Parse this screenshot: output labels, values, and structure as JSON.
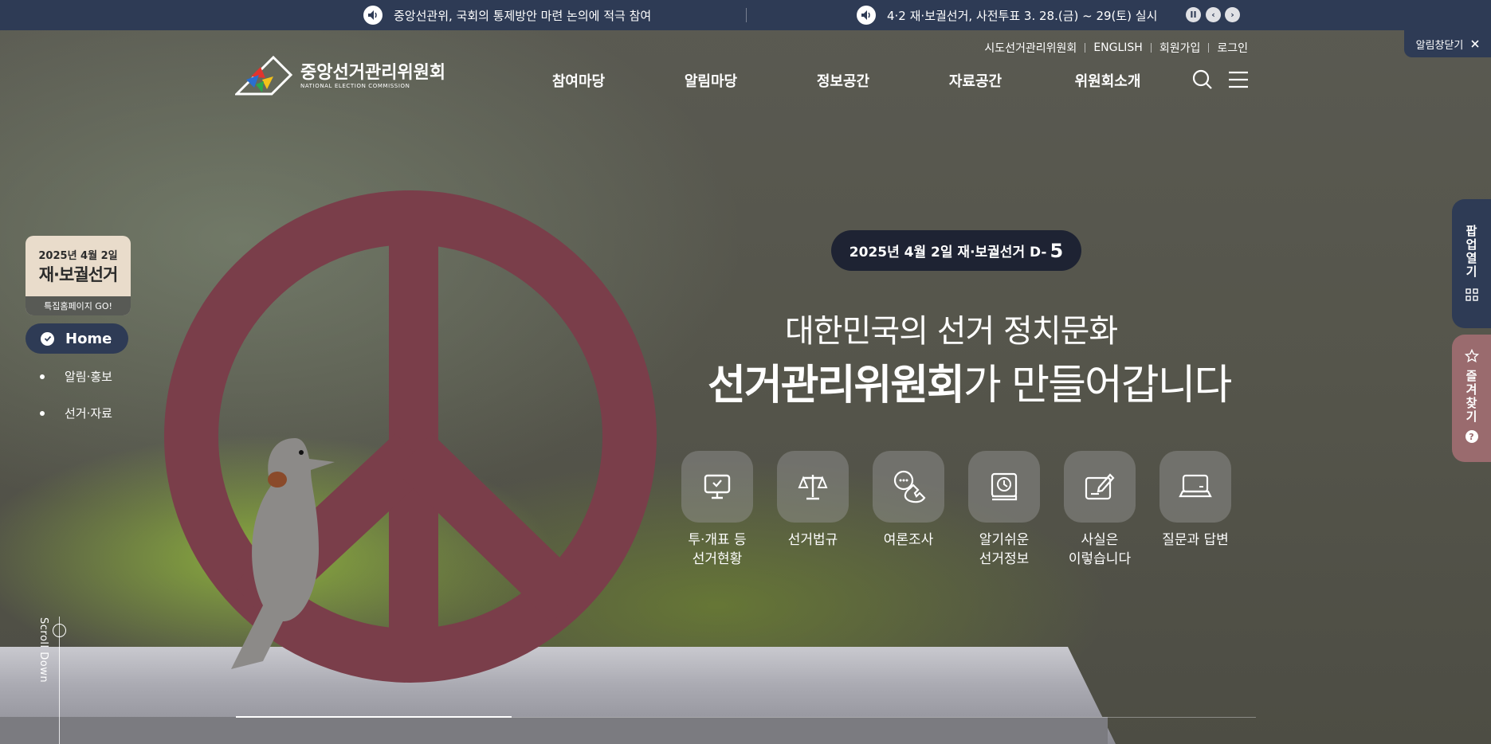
{
  "notices": [
    {
      "text": "중앙선관위, 국회의 통제방안 마련 논의에 적극 참여"
    },
    {
      "text": "4·2 재·보궐선거, 사전투표 3. 28.(금) ~ 29(토) 실시"
    }
  ],
  "notice_controls": {
    "pause": "II",
    "prev": "‹",
    "next": "›"
  },
  "alert_close": {
    "label": "알림창닫기",
    "icon": "close-icon"
  },
  "utility_links": [
    "시도선거관리위원회",
    "ENGLISH",
    "회원가입",
    "로그인"
  ],
  "logo": {
    "title": "중앙선거관리위원회",
    "subtitle": "NATIONAL ELECTION COMMISSION"
  },
  "nav": [
    "참여마당",
    "알림마당",
    "정보공간",
    "자료공간",
    "위원회소개"
  ],
  "special_banner": {
    "date": "2025년 4월 2일",
    "title": "재·보궐선거",
    "link": "특집홈페이지 GO!"
  },
  "sidebar": {
    "home": "Home",
    "items": [
      "알림·홍보",
      "선거·자료"
    ]
  },
  "scroll_text": "Scroll Down",
  "hero": {
    "dday_prefix": "2025년 4월 2일 재·보궐선거 D-",
    "dday_number": "5",
    "line1": "대한민국의 선거 정치문화",
    "line2_bold": "선거관리위원회",
    "line2_rest": "가 만들어갑니다"
  },
  "quick_links": [
    {
      "label": "투·개표 등\n선거현황",
      "icon": "monitor-icon"
    },
    {
      "label": "선거법규",
      "icon": "scale-icon"
    },
    {
      "label": "여론조사",
      "icon": "phone-chat-icon"
    },
    {
      "label": "알기쉬운\n선거정보",
      "icon": "book-clock-icon"
    },
    {
      "label": "사실은\n이렇습니다",
      "icon": "edit-board-icon"
    },
    {
      "label": "질문과 답변",
      "icon": "laptop-icon"
    }
  ],
  "right_tabs": {
    "popup": "팝업열기",
    "favorite": "즐겨찾기",
    "help": "?"
  },
  "slider_progress": 0.27,
  "colors": {
    "navy": "#2e3b55",
    "dark_pill": "#1e2333",
    "favorite": "#9a6b6e",
    "peace_sign": "#7a3e4a"
  }
}
